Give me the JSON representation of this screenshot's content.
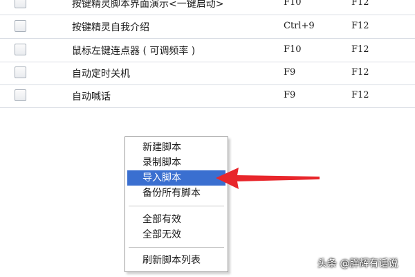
{
  "script_list": {
    "rows": [
      {
        "name": "按键精灵脚本界面演示<一键启动>",
        "hotkey_start": "F10",
        "hotkey_stop": "F12"
      },
      {
        "name": "按键精灵自我介绍",
        "hotkey_start": "Ctrl+9",
        "hotkey_stop": "F12"
      },
      {
        "name": "鼠标左键连点器 ( 可调频率 )",
        "hotkey_start": "F10",
        "hotkey_stop": "F12"
      },
      {
        "name": "自动定时关机",
        "hotkey_start": "F9",
        "hotkey_stop": "F12"
      },
      {
        "name": "自动喊话",
        "hotkey_start": "F9",
        "hotkey_stop": "F12"
      }
    ]
  },
  "context_menu": {
    "new_script": "新建脚本",
    "record_script": "录制脚本",
    "import_script": "导入脚本",
    "backup_all": "备份所有脚本",
    "enable_all": "全部有效",
    "disable_all": "全部无效",
    "refresh_list": "刷新脚本列表"
  },
  "annotation": {
    "arrow_color": "#e8262b",
    "highlight_color": "#3a6fd0"
  },
  "watermark": "头条 @胖辉有话说"
}
